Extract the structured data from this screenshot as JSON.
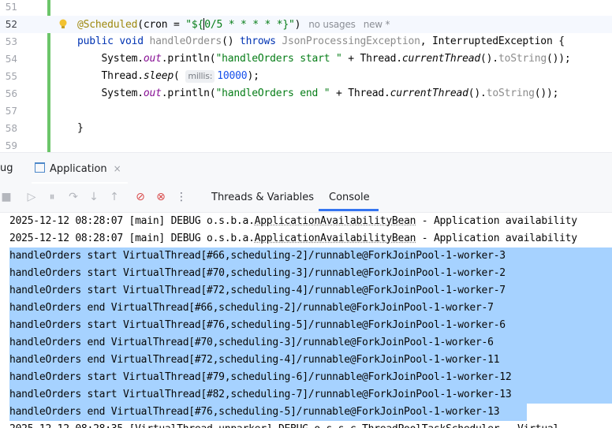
{
  "editor": {
    "lines": [
      {
        "n": "51",
        "parts": []
      },
      {
        "n": "52",
        "current": true,
        "parts": [
          {
            "t": "@Scheduled",
            "c": "ann"
          },
          {
            "t": "(cron = ",
            "c": ""
          },
          {
            "t": "\"${",
            "c": "str"
          },
          {
            "t": "0/5 * * * * *",
            "c": "str"
          },
          {
            "t": "}\"",
            "c": "str"
          },
          {
            "t": ")",
            "c": ""
          }
        ],
        "inlays": [
          "no usages",
          "new *"
        ]
      },
      {
        "n": "53",
        "parts": [
          {
            "t": "public ",
            "c": "kw"
          },
          {
            "t": "void ",
            "c": "kw"
          },
          {
            "t": "handleOrders",
            "c": "dim"
          },
          {
            "t": "() ",
            "c": ""
          },
          {
            "t": "throws ",
            "c": "kw"
          },
          {
            "t": "JsonProcessingException",
            "c": "dim"
          },
          {
            "t": ", ",
            "c": ""
          },
          {
            "t": "InterruptedException",
            "c": ""
          },
          {
            "t": " {",
            "c": ""
          }
        ]
      },
      {
        "n": "54",
        "parts": [
          {
            "t": "    System.",
            "c": ""
          },
          {
            "t": "out",
            "c": "field"
          },
          {
            "t": ".println(",
            "c": ""
          },
          {
            "t": "\"handleOrders start \"",
            "c": "str"
          },
          {
            "t": " + Thread.",
            "c": ""
          },
          {
            "t": "currentThread",
            "c": "ital"
          },
          {
            "t": "().",
            "c": ""
          },
          {
            "t": "toString",
            "c": "dim"
          },
          {
            "t": "());",
            "c": ""
          }
        ]
      },
      {
        "n": "55",
        "parts": [
          {
            "t": "    Thread.",
            "c": ""
          },
          {
            "t": "sleep",
            "c": "ital"
          },
          {
            "t": "( ",
            "c": ""
          },
          {
            "t": "millis:",
            "c": "hint"
          },
          {
            "t": "10000",
            "c": "num"
          },
          {
            "t": ");",
            "c": ""
          }
        ]
      },
      {
        "n": "56",
        "parts": [
          {
            "t": "    System.",
            "c": ""
          },
          {
            "t": "out",
            "c": "field"
          },
          {
            "t": ".println(",
            "c": ""
          },
          {
            "t": "\"handleOrders end \"",
            "c": "str"
          },
          {
            "t": " + Thread.",
            "c": ""
          },
          {
            "t": "currentThread",
            "c": "ital"
          },
          {
            "t": "().",
            "c": ""
          },
          {
            "t": "toString",
            "c": "dim"
          },
          {
            "t": "());",
            "c": ""
          }
        ]
      },
      {
        "n": "57",
        "parts": []
      },
      {
        "n": "58",
        "parts": [
          {
            "t": "}",
            "c": ""
          }
        ]
      },
      {
        "n": "59",
        "parts": []
      }
    ]
  },
  "debug_panel": {
    "left_tab_label": "ug",
    "run_tab_label": "Application",
    "run_tab_close": "×"
  },
  "toolbar": {
    "icons": [
      "stop-icon",
      "resume-icon",
      "pause-icon",
      "step-over-icon",
      "step-into-icon",
      "step-out-icon",
      "view-breakpoints-icon",
      "mute-breakpoints-icon",
      "more-options-icon"
    ],
    "tabs": [
      "Threads & Variables",
      "Console"
    ],
    "active_tab": "Console"
  },
  "console": {
    "lines": [
      {
        "sel": false,
        "text": "2025-12-12 08:28:07 [main] DEBUG o.s.b.a.",
        "under": "ApplicationAvailabilityBean",
        "rest": " - Application availability"
      },
      {
        "sel": false,
        "text": "2025-12-12 08:28:07 [main] DEBUG o.s.b.a.",
        "under": "ApplicationAvailabilityBean",
        "rest": " - Application availability"
      },
      {
        "sel": true,
        "text": "handleOrders start VirtualThread[#66,scheduling-2]/runnable@ForkJoinPool-1-worker-3"
      },
      {
        "sel": true,
        "text": "handleOrders start VirtualThread[#70,scheduling-3]/runnable@ForkJoinPool-1-worker-2"
      },
      {
        "sel": true,
        "text": "handleOrders start VirtualThread[#72,scheduling-4]/runnable@ForkJoinPool-1-worker-7"
      },
      {
        "sel": true,
        "text": "handleOrders end VirtualThread[#66,scheduling-2]/runnable@ForkJoinPool-1-worker-7"
      },
      {
        "sel": true,
        "text": "handleOrders start VirtualThread[#76,scheduling-5]/runnable@ForkJoinPool-1-worker-6"
      },
      {
        "sel": true,
        "text": "handleOrders end VirtualThread[#70,scheduling-3]/runnable@ForkJoinPool-1-worker-6"
      },
      {
        "sel": true,
        "text": "handleOrders end VirtualThread[#72,scheduling-4]/runnable@ForkJoinPool-1-worker-11"
      },
      {
        "sel": true,
        "text": "handleOrders start VirtualThread[#79,scheduling-6]/runnable@ForkJoinPool-1-worker-12"
      },
      {
        "sel": true,
        "text": "handleOrders start VirtualThread[#82,scheduling-7]/runnable@ForkJoinPool-1-worker-13"
      },
      {
        "sel": true,
        "text": "handleOrders end VirtualThread[#76,scheduling-5]/runnable@ForkJoinPool-1-worker-13"
      },
      {
        "sel": false,
        "text": "2025-12-12 08:28:35 [VirtualThread-unparker] DEBUG o.s.s.c.ThreadPoolTaskScheduler - Virtual"
      }
    ]
  }
}
